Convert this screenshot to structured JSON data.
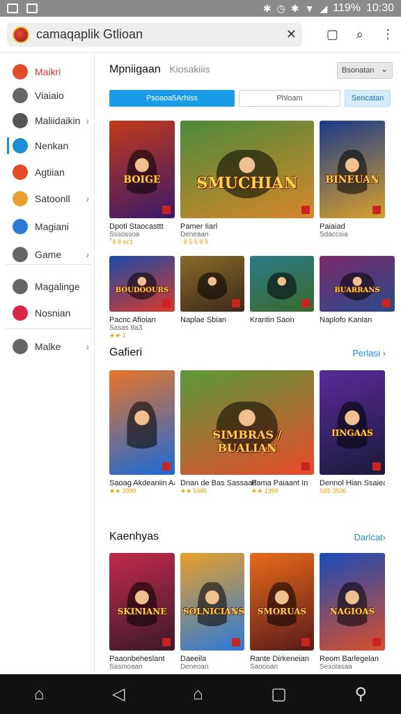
{
  "status": {
    "battery": "119%",
    "time": "10:30"
  },
  "search": {
    "query": "camaqaplik Gtlioan"
  },
  "sidebar": {
    "items": [
      {
        "label": "Maikri",
        "icon": "home-icon",
        "color": "#e24a2b"
      },
      {
        "label": "Viaiaio",
        "icon": "document-icon",
        "color": "#666666"
      },
      {
        "label": "Maliidaikin",
        "icon": "folder-icon",
        "color": "#555555"
      },
      {
        "label": "Nenkan",
        "icon": "globe-icon",
        "color": "#1a8fd8"
      },
      {
        "label": "Agtiian",
        "icon": "chrome-icon",
        "color": "#e24a2b"
      },
      {
        "label": "Satoonll",
        "icon": "game-icon",
        "color": "#e8a030"
      },
      {
        "label": "Magiani",
        "icon": "avatar-icon",
        "color": "#2a7bd8"
      },
      {
        "label": "Game",
        "icon": "star-icon",
        "color": "#666666"
      },
      {
        "label": "Magalinge",
        "icon": "location-icon",
        "color": "#666666"
      },
      {
        "label": "Nosnian",
        "icon": "flower-icon",
        "color": "#d8284a"
      },
      {
        "label": "Malke",
        "icon": "settings-icon",
        "color": "#666666"
      }
    ]
  },
  "main": {
    "title": "Mpniigaan",
    "subtitle": "Kiosakiiis",
    "dropdown": "Bsonatan"
  },
  "filters": [
    "Psoaoa5Arhiss",
    "Phloam",
    "Sencatan"
  ],
  "featured": [
    {
      "title": "Dpotl Staocasttt",
      "sub": "Sssossoa",
      "stars": "ꜛ9 8 oc1",
      "art": "BOIGE",
      "c1": "#c23a1a",
      "c2": "#3a1a6a"
    },
    {
      "title": "Pamer Iiarl",
      "sub": "Deneaan",
      "stars": "ᐧ 8 5 5 8 9",
      "art": "SMUCHIAN",
      "c1": "#4a8a3a",
      "c2": "#d8862a"
    },
    {
      "title": "Paiaiad",
      "sub": "Sdaccsia",
      "stars": "",
      "art": "BINEUAN",
      "c1": "#1a3a8a",
      "c2": "#d8a02a"
    }
  ],
  "row2": [
    {
      "title": "Pacnc Afioian",
      "sub": "Sasas 8a3",
      "stars": "★★ 1",
      "art": "BOUDOOURS",
      "c1": "#1a4aa8",
      "c2": "#d83a2a"
    },
    {
      "title": "Naplae Sbian",
      "sub": "",
      "stars": "",
      "art": "",
      "c1": "#8a6a2a",
      "c2": "#3a2a1a"
    },
    {
      "title": "Krantin Saon",
      "sub": "",
      "stars": "",
      "art": "",
      "c1": "#2a7a8a",
      "c2": "#3a6a2a"
    },
    {
      "title": "Naplofo Kanlan",
      "sub": "",
      "stars": "",
      "art": "BUARRANS",
      "c1": "#7a2a6a",
      "c2": "#2a4a8a"
    }
  ],
  "section1": {
    "title": "Gafieri",
    "link": "Perlasi ›"
  },
  "gameri": [
    {
      "title": "Saoag Akdeaniin Aaridon",
      "sub": "",
      "stars": "★★ 3999",
      "art": "",
      "c1": "#e8742a",
      "c2": "#1a6ad8"
    },
    {
      "title": "Dnan de Bas Sassaad",
      "sub": "",
      "stars": "★★ 5985",
      "art": "SIMBRAS / BUALIAN",
      "c1": "#5a9a3a",
      "c2": "#e84a2a"
    },
    {
      "title": "Dennol Hian Ssaieahn",
      "sub": "",
      "stars": "S85 3536",
      "art": "IINGAAS",
      "c1": "#5a2a9a",
      "c2": "#1a1a3a"
    }
  ],
  "gameri_extra": {
    "title": "Pama Paiaant In",
    "stars": "★★ 1399"
  },
  "section2": {
    "title": "Kaenhyas",
    "link": "Darlcat›"
  },
  "kaenhyas": [
    {
      "title": "Paaonbeheslant",
      "sub": "Sasmoaan",
      "art": "SKINIANE",
      "c1": "#c22a4a",
      "c2": "#3a1a2a"
    },
    {
      "title": "Daeeila",
      "sub": "Deneoan",
      "art": "SOLNICIANS",
      "c1": "#e8a02a",
      "c2": "#2a7ad8"
    },
    {
      "title": "Rante Dirkeneian",
      "sub": "Saoooan",
      "art": "SMORUAS",
      "c1": "#e86a1a",
      "c2": "#5a1a1a"
    },
    {
      "title": "Reom Barlegelan",
      "sub": "Sesolasaa",
      "art": "NAGIOAS",
      "c1": "#1a4ab8",
      "c2": "#d8502a"
    }
  ],
  "nav": [
    "home-icon",
    "back-icon",
    "home-circle-icon",
    "recent-apps-icon",
    "search-nav-icon"
  ],
  "colors": {
    "accent": "#1a9be8",
    "active": "#e24a2b"
  }
}
